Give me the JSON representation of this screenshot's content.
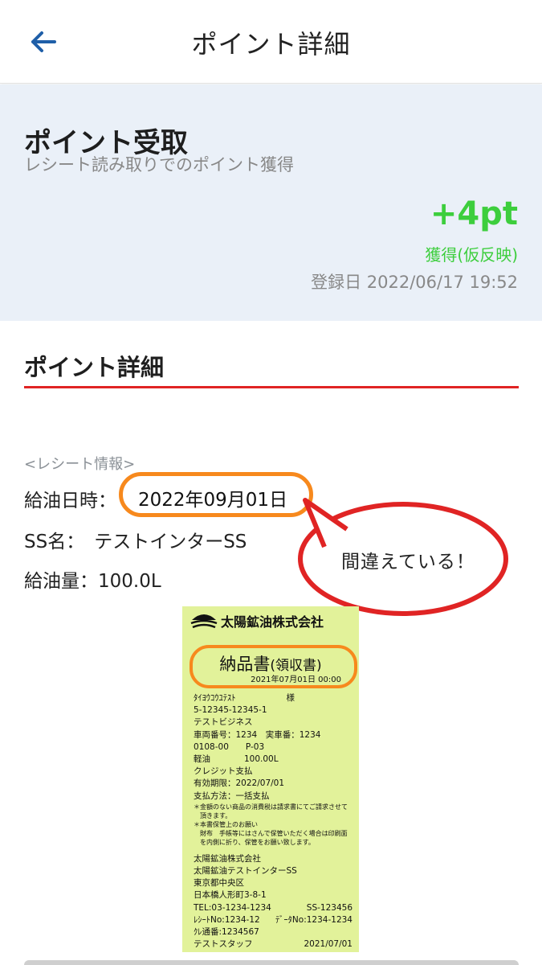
{
  "header": {
    "title": "ポイント詳細"
  },
  "summary": {
    "title": "ポイント受取",
    "subtitle": "レシート読み取りでのポイント獲得",
    "points": "+4pt",
    "status": "獲得(仮反映)",
    "registered": "登録日 2022/06/17 19:52",
    "accent_color": "#3dce3d"
  },
  "details": {
    "section_title": "ポイント詳細",
    "receipt_info_label": "<レシート情報>",
    "fuel_datetime_label": "給油日時：",
    "fuel_datetime_value": "2022年09月01日",
    "ss_name_label": "SS名：",
    "ss_name_value": "テストインターSS",
    "fuel_amount_label": "給油量：",
    "fuel_amount_value": "100.0L"
  },
  "annotation": {
    "callout_text": "間違えている！",
    "highlight_color": "#f7891d",
    "callout_color": "#e02424"
  },
  "receipt": {
    "company": "太陽鉱油株式会社",
    "title": "納品書",
    "title_small": "(領収書)",
    "date": "2021年07月01日 00:00",
    "lines": [
      "ﾀｲﾖｳｺｳﾕﾃｽﾄ　　　　　　様",
      "5-12345-12345-1",
      "テストビジネス",
      "車両番号：1234　実車番：1234",
      "0108-00　　P-03",
      "軽油　　　　100.00L",
      "クレジット支払",
      "有効期限：2022/07/01",
      "支払方法：一括支払"
    ],
    "notes": [
      "＊金額のない商品の消費税は請求書にてご請求させて",
      "　頂きます。",
      "＊本書保管上のお願い",
      "　財布　手帳等にはさんで保管いただく場合は印刷面",
      "　を内側に折り、保管をお願い致します。"
    ],
    "footer": [
      "太陽鉱油株式会社",
      "太陽鉱油テストインターSS",
      "東京都中央区",
      "日本橋人形町3-8-1"
    ],
    "tel": "TEL:03-1234-1234",
    "ss_code": "SS-123456",
    "receipt_no": "ﾚｼｰﾄNo:1234-12",
    "data_no": "ﾃﾞｰﾀNo:1234-1234",
    "card_no": "ｸﾚ通番:1234567",
    "staff": "テストスタッフ",
    "staff_date": "2021/07/01"
  }
}
